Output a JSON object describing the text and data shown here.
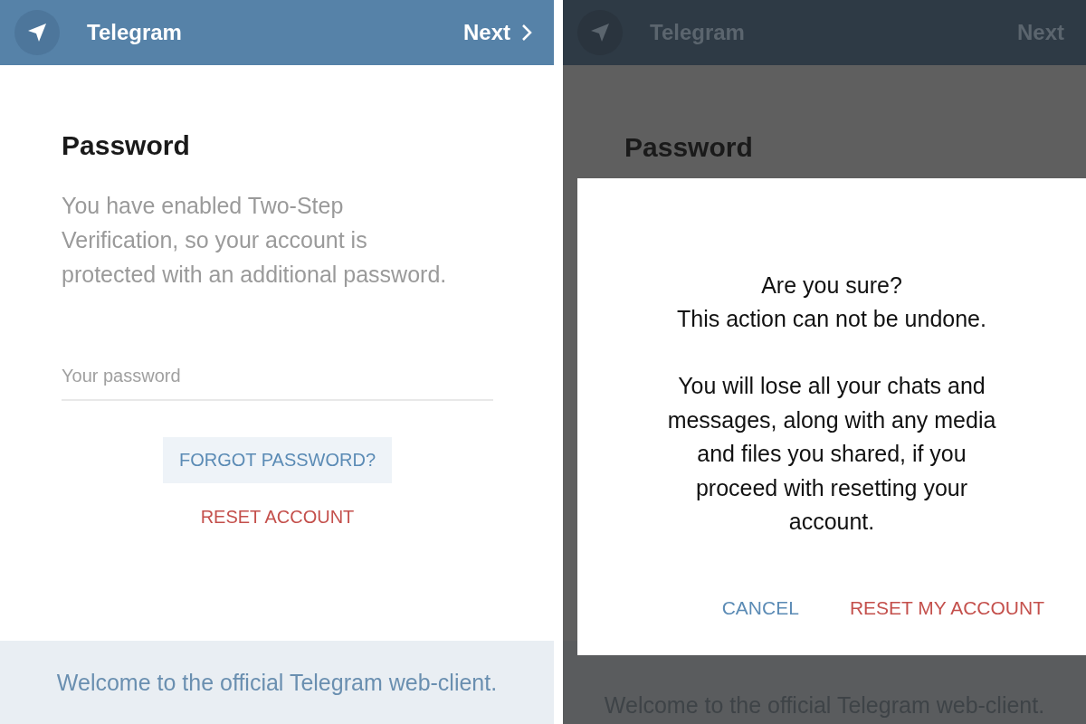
{
  "panels": [
    {
      "dimmed": false,
      "header": {
        "title": "Telegram",
        "next": "Next"
      },
      "form": {
        "heading": "Password",
        "description_lines": [
          "You have enabled Two-Step",
          "Verification, so your account is",
          "protected with an additional password."
        ],
        "password_field": {
          "placeholder": "Your password"
        },
        "forgot_button": "FORGOT PASSWORD?",
        "reset_button": "RESET ACCOUNT"
      },
      "footer": "Welcome to the official Telegram web-client."
    },
    {
      "dimmed": true,
      "header": {
        "title": "Telegram",
        "next": "Next"
      },
      "form": {
        "heading": "Password"
      },
      "footer": "Welcome to the official Telegram web-client.",
      "dialog": {
        "message_lines": [
          "Are you sure?",
          "This action can not be undone."
        ],
        "warning_lines": [
          "You will lose all your chats and",
          "messages, along with any media",
          "and files you shared, if you",
          "proceed with resetting your",
          "account."
        ],
        "buttons": [
          {
            "label": "CANCEL",
            "kind": "cancel"
          },
          {
            "label": "RESET MY ACCOUNT",
            "kind": "destructive"
          }
        ]
      }
    }
  ]
}
